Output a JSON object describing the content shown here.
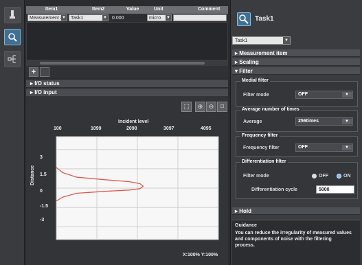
{
  "table": {
    "headers": [
      "Item1",
      "Item2",
      "Value",
      "Unit",
      "Comment"
    ],
    "row": {
      "item1": "Measurement a",
      "item2": "Task1",
      "value": "0.000",
      "unit": "micro"
    }
  },
  "sections": {
    "io_status": "I/O status",
    "io_input": "I/O input"
  },
  "graph": {
    "title": "Incident level",
    "ylabel": "Distance",
    "readout": "X:100% Y:100%"
  },
  "chart_data": {
    "type": "line",
    "title": "Incident level",
    "xlabel": "Incident level",
    "ylabel": "Distance",
    "x_ticks": [
      "100",
      "1099",
      "2098",
      "3097",
      "4095"
    ],
    "y_ticks": [
      "3",
      "1.5",
      "0",
      "-1.5",
      "-3"
    ],
    "xlim": [
      100,
      4095
    ],
    "ylim": [
      -4,
      4
    ],
    "series": [
      {
        "x": [
          100,
          260,
          600,
          1300,
          1900,
          2160,
          2240,
          2160,
          1900,
          1300,
          600,
          260,
          100
        ],
        "y": [
          1.6,
          1.2,
          0.85,
          0.65,
          0.5,
          0.35,
          0.15,
          -0.05,
          -0.15,
          -0.25,
          -0.4,
          -0.7,
          -1.0
        ],
        "color": "#e0584c"
      }
    ]
  },
  "right": {
    "title": "Task1",
    "task_select": "Task1",
    "sections": [
      "Measurement item",
      "Scaling",
      "Filter",
      "Hold"
    ],
    "medial_filter": {
      "title": "Medial filter",
      "label": "Filter mode",
      "value": "OFF"
    },
    "average": {
      "title": "Average number of times",
      "label": "Average",
      "value": "256times"
    },
    "frequency": {
      "title": "Frequency filter",
      "label": "Frequency filter",
      "value": "OFF"
    },
    "differentiation": {
      "title": "Differentiation filter",
      "mode_label": "Filter mode",
      "off": "OFF",
      "on": "ON",
      "cycle_label": "Differentiation cycle",
      "cycle_value": "5000"
    },
    "guidance_title": "Guidance",
    "guidance_text": "You can reduce the irregularity of measured values and components of noise with the filtering process."
  },
  "colors": {
    "accent": "#3f6f92",
    "curve": "#e0584c"
  }
}
